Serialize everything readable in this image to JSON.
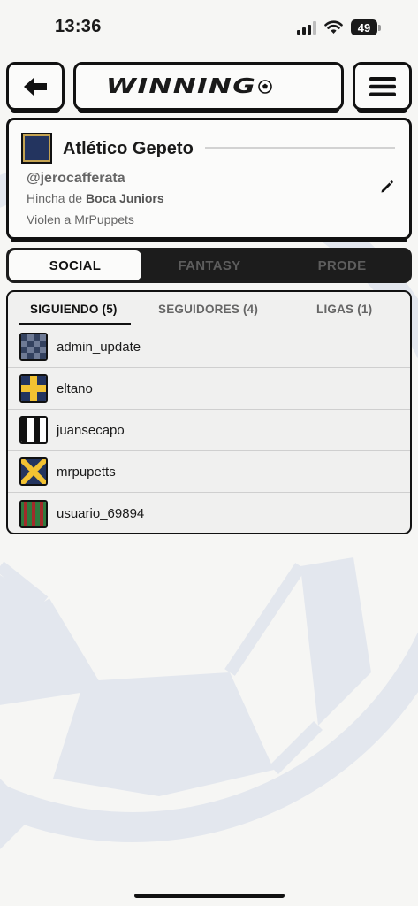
{
  "status_bar": {
    "time": "13:36",
    "battery": "49"
  },
  "header": {
    "logo": "WINNING"
  },
  "profile": {
    "team_name": "Atlético Gepeto",
    "username": "@jerocafferata",
    "hincha_prefix": "Hincha de",
    "hincha_team": "Boca Juniors",
    "bio": "Violen a MrPuppets"
  },
  "main_tabs": [
    {
      "label": "SOCIAL",
      "active": true
    },
    {
      "label": "FANTASY",
      "active": false
    },
    {
      "label": "PRODE",
      "active": false
    }
  ],
  "sub_tabs": [
    {
      "label": "SIGUIENDO (5)",
      "active": true
    },
    {
      "label": "SEGUIDORES (4)",
      "active": false
    },
    {
      "label": "LIGAS (1)",
      "active": false
    }
  ],
  "following": [
    {
      "name": "admin_update",
      "badge": "checkered-navy-grey"
    },
    {
      "name": "eltano",
      "badge": "yellow-cross-navy"
    },
    {
      "name": "juansecapo",
      "badge": "black-white-stripes"
    },
    {
      "name": "mrpupetts",
      "badge": "yellow-saltire-navy"
    },
    {
      "name": "usuario_69894",
      "badge": "green-red-stripes"
    }
  ],
  "colors": {
    "background": "#f6f6f4",
    "dark": "#111111",
    "team_navy": "#23345f",
    "team_gold": "#c4a352",
    "bg_ball": "#e3e7ee"
  }
}
